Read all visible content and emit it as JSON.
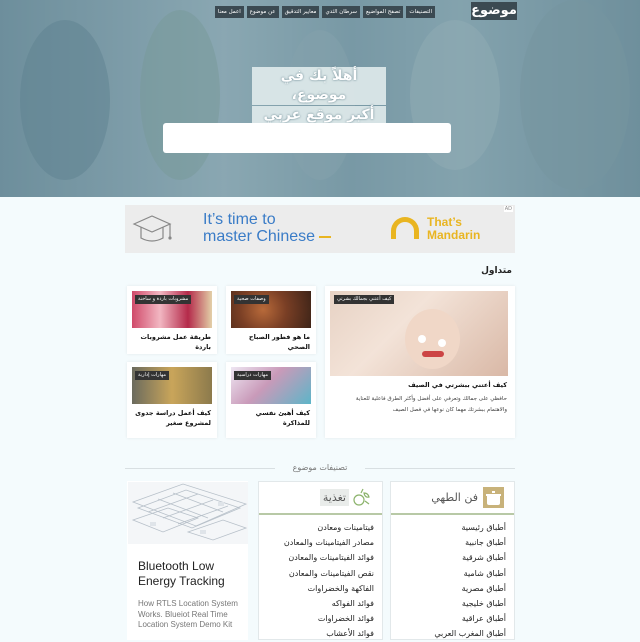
{
  "header": {
    "logo": "موضوع",
    "nav": [
      "التصنيفات",
      "تصفح المواضيع",
      "سرطان الثدي",
      "معايير التدقيق",
      "عن موضوع",
      "اعمل معنا"
    ],
    "hero_line1": "أهلاً بك في موضوع،",
    "hero_line2": "أكبر موقع عربي بالعالم.",
    "search_placeholder": ""
  },
  "ad": {
    "line1": "It’s time to",
    "line2": "master Chinese",
    "brand_line1": "That’s",
    "brand_line2": "Mandarin",
    "ad_mark": "AD"
  },
  "trending": {
    "title": "متداول",
    "main": {
      "badge": "كيف أعتني بجمالك بشرتي",
      "title": "كيف أعتني ببشرتي في الصيف",
      "desc": "حافظي على جمالك وتعرفي على أفضل وأكثر الطرق فاعلية للعناية والاهتمام ببشرتك مهما كان نوعها في فصل الصيف"
    },
    "items": [
      {
        "badge": "وصفات صحية",
        "title": "ما هو فطور الصباح الصحي"
      },
      {
        "badge": "مشروبات باردة و ساخنة",
        "title": "طريقة عمل مشروبات باردة"
      },
      {
        "badge": "مهارات دراسية",
        "title": "كيف أهيئ نفسي للمذاكرة"
      },
      {
        "badge": "مهارات إدارية",
        "title": "كيف أعمل دراسة جدوى لمشروع صغير"
      }
    ]
  },
  "categories": {
    "title": "تصنيفات موضوع",
    "cooking": {
      "label": "فن الطهي",
      "items": [
        "أطباق رئيسية",
        "أطباق جانبية",
        "أطباق شرقية",
        "أطباق شامية",
        "أطباق مصرية",
        "أطباق خليجية",
        "أطباق عراقية",
        "أطباق المغرب العربي"
      ]
    },
    "nutrition": {
      "label": "تغذية",
      "items": [
        "فيتامينات ومعادن",
        "مصادر الفيتامينات والمعادن",
        "فوائد الفيتامينات والمعادن",
        "نقص الفيتامينات والمعادن",
        "الفاكهة والخضراوات",
        "فوائد الفواكه",
        "فوائد الخضراوات",
        "فوائد الأعشاب"
      ]
    },
    "ad_card": {
      "heading": "Bluetooth Low Energy Tracking",
      "desc": "How RTLS Location System Works. Blueiot Real Time Location System Demo Kit"
    }
  }
}
